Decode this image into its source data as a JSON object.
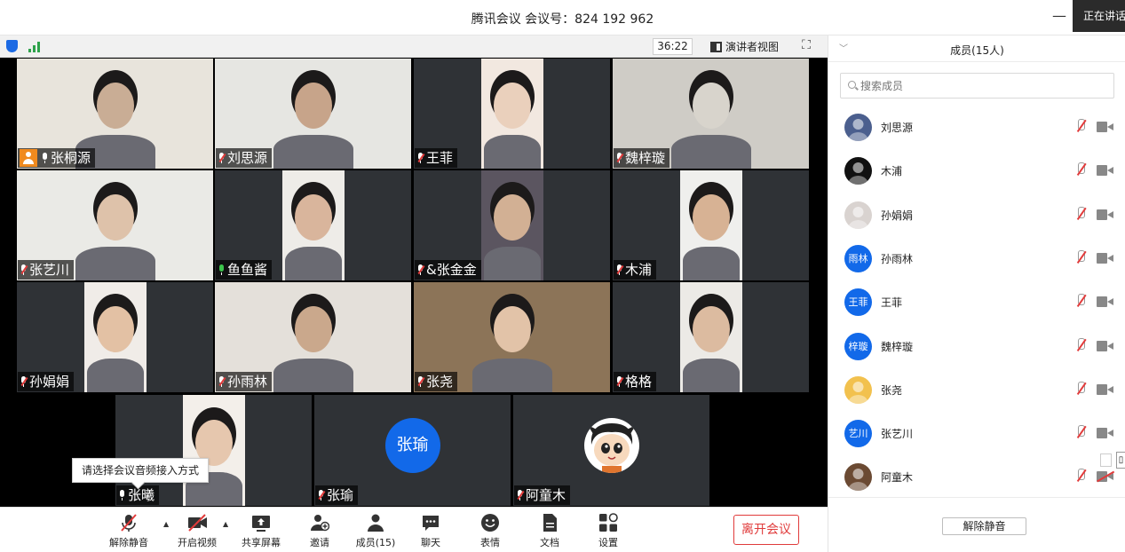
{
  "titlebar": {
    "title": "腾讯会议 会议号：824 192 962",
    "speaking_badge": "正在讲话",
    "minimize_glyph": "—"
  },
  "videobar": {
    "timer": "36:22",
    "speaker_view_label": "演讲者视图",
    "fullscreen_glyph": "⛶"
  },
  "tiles": [
    {
      "name": "张桐源",
      "mic": "host",
      "face": "#c9ad95",
      "bg": "#e8e4dc"
    },
    {
      "name": "刘思源",
      "mic": "muted",
      "face": "#c7a48a",
      "bg": "#e6e6e2"
    },
    {
      "name": "王菲",
      "mic": "muted",
      "face": "#ead0bc",
      "bg": "#f2e8e0"
    },
    {
      "name": "魏梓璇",
      "mic": "muted",
      "face": "#d8d4cc",
      "bg": "#cfccc6"
    },
    {
      "name": "张艺川",
      "mic": "muted",
      "face": "#dec2aa",
      "bg": "#eaeae6"
    },
    {
      "name": "鱼鱼酱",
      "mic": "green",
      "face": "#d9b59c",
      "bg": "#eeece8"
    },
    {
      "name": "&张金金",
      "mic": "muted",
      "face": "#d2b094",
      "bg": "#5b5560"
    },
    {
      "name": "木浦",
      "mic": "muted",
      "face": "#d7b294",
      "bg": "#efefed"
    },
    {
      "name": "孙娟娟",
      "mic": "muted",
      "face": "#e3c1a4",
      "bg": "#f0ece8"
    },
    {
      "name": "孙雨林",
      "mic": "muted",
      "face": "#caa88c",
      "bg": "#e4e0da"
    },
    {
      "name": "张尧",
      "mic": "muted",
      "face": "#e2c3a8",
      "bg": "#8c7458"
    },
    {
      "name": "格格",
      "mic": "muted",
      "face": "#dcbba0",
      "bg": "#eceae6"
    },
    {
      "name": "张曦",
      "mic": "normal",
      "face": "#e6c7ae",
      "bg": "#f3efea"
    },
    {
      "name": "张瑜",
      "mic": "muted",
      "avatar_text": "张瑜"
    },
    {
      "name": "阿童木",
      "mic": "muted",
      "avatar": "astro-boy"
    }
  ],
  "tooltip": "请选择会议音频接入方式",
  "toolbar": {
    "unmute": "解除静音",
    "video": "开启视频",
    "share": "共享屏幕",
    "invite": "邀请",
    "members": "成员(15)",
    "chat": "聊天",
    "emoji": "表情",
    "docs": "文档",
    "settings": "设置",
    "leave": "离开会议"
  },
  "panel": {
    "title": "成员(15人)",
    "search_placeholder": "搜索成员",
    "members": [
      {
        "name": "刘思源",
        "avatar": "photo",
        "color": "#4b5f8e"
      },
      {
        "name": "木浦",
        "avatar": "photo",
        "color": "#111111"
      },
      {
        "name": "孙娟娟",
        "avatar": "photo",
        "color": "#d9d3d0"
      },
      {
        "name": "孙雨林",
        "avatar_text": "雨林",
        "color": "#1269e9"
      },
      {
        "name": "王菲",
        "avatar_text": "王菲",
        "color": "#1269e9"
      },
      {
        "name": "魏梓璇",
        "avatar_text": "梓璇",
        "color": "#1269e9"
      },
      {
        "name": "张尧",
        "avatar": "photo",
        "color": "#f2c14e"
      },
      {
        "name": "张艺川",
        "avatar_text": "艺川",
        "color": "#1269e9"
      },
      {
        "name": "阿童木",
        "avatar": "photo",
        "color": "#6b4a33",
        "cam_off": true
      }
    ],
    "unmute_all": "解除静音"
  },
  "colors": {
    "accent_blue": "#1269e9",
    "danger_red": "#e03b3b",
    "host_orange": "#f08a1e",
    "stage_black": "#000000"
  }
}
